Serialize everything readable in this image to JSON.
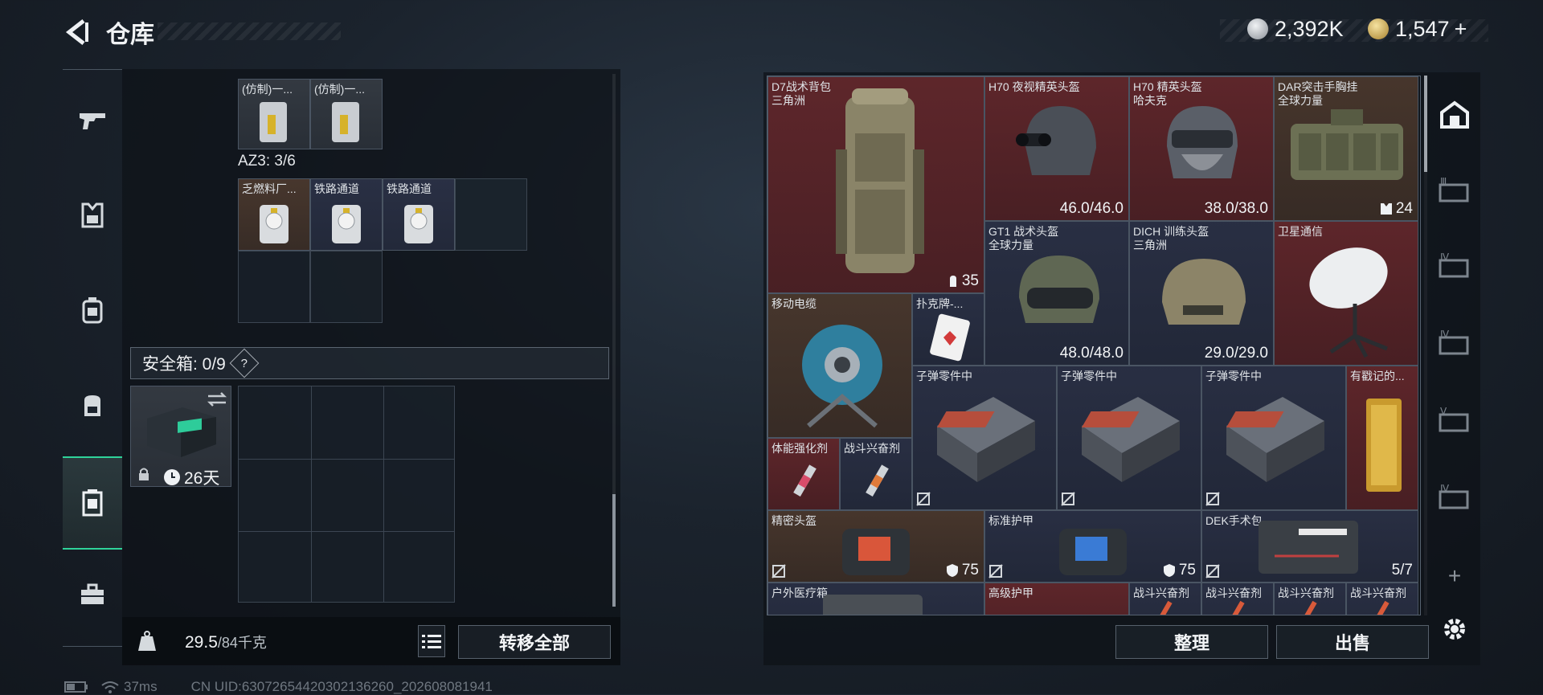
{
  "header": {
    "title": "仓库",
    "currency_silver": "2,392K",
    "currency_gold": "1,547",
    "gold_plus": "+"
  },
  "left_nav": [
    "weapons-icon",
    "armor-icon",
    "chest-rig-icon",
    "backpack-icon",
    "safe-box-icon",
    "toolbox-icon"
  ],
  "left_panel": {
    "top_items": [
      {
        "label": "(仿制)一..."
      },
      {
        "label": "(仿制)一..."
      }
    ],
    "az3_label": "AZ3: 3/6",
    "az3_items": [
      {
        "label": "乏燃料厂..."
      },
      {
        "label": "铁路通道"
      },
      {
        "label": "铁路通道"
      }
    ],
    "safe_box": {
      "label": "安全箱: 0/9",
      "help": "?",
      "days": "26天"
    },
    "weight": {
      "current": "29.5",
      "capacity": "/84千克"
    },
    "transfer_all": "转移全部"
  },
  "right_panel": {
    "items": [
      {
        "label": "D7战术背包",
        "sub": "三角洲",
        "value": "35"
      },
      {
        "label": "H70 夜视精英头盔",
        "value": "46.0/46.0"
      },
      {
        "label": "H70 精英头盔",
        "sub": "哈夫克",
        "value": "38.0/38.0"
      },
      {
        "label": "DAR突击手胸挂",
        "sub": "全球力量",
        "value": "24"
      },
      {
        "label": "GT1 战术头盔",
        "sub": "全球力量",
        "value": "48.0/48.0"
      },
      {
        "label": "DICH 训练头盔",
        "sub": "三角洲",
        "value": "29.0/29.0"
      },
      {
        "label": "卫星通信"
      },
      {
        "label": "移动电缆"
      },
      {
        "label": "扑克牌-..."
      },
      {
        "label": "子弹零件中"
      },
      {
        "label": "子弹零件中"
      },
      {
        "label": "子弹零件中"
      },
      {
        "label": "有戳记的..."
      },
      {
        "label": "体能强化剂"
      },
      {
        "label": "战斗兴奋剂"
      },
      {
        "label": "精密头盔",
        "value": "75"
      },
      {
        "label": "标准护甲",
        "value": "75"
      },
      {
        "label": "DEK手术包",
        "value": "5/7"
      },
      {
        "label": "户外医疗箱"
      },
      {
        "label": "高级护甲"
      },
      {
        "label": "战斗兴奋剂"
      },
      {
        "label": "战斗兴奋剂"
      },
      {
        "label": "战斗兴奋剂"
      },
      {
        "label": "战斗兴奋剂"
      }
    ],
    "sort_button": "整理",
    "sell_button": "出售"
  },
  "right_tabs": [
    "Ⅲ",
    "Ⅳ",
    "Ⅳ",
    "Ⅴ",
    "Ⅳ",
    "+"
  ],
  "status_bar": {
    "ping": "37ms",
    "uid": "CN UID:6307265442030213626​0_202608081941"
  },
  "colors": {
    "accent": "#2fd39a",
    "red_cell": "#682c30",
    "blue_cell": "#2c3248"
  }
}
